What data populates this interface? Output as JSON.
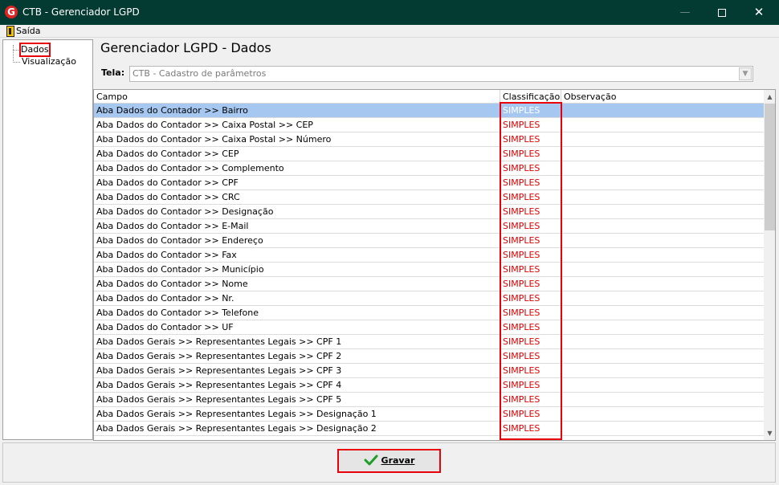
{
  "window": {
    "title": "CTB - Gerenciador LGPD",
    "app_icon_letter": "G",
    "minimize_glyph": "—",
    "close_glyph": "✕"
  },
  "menu": {
    "saida": "Saída"
  },
  "tree": {
    "items": [
      {
        "label": "Dados",
        "selected": true
      },
      {
        "label": "Visualização",
        "selected": false
      }
    ]
  },
  "header": {
    "title": "Gerenciador LGPD - Dados"
  },
  "tela": {
    "label": "Tela:",
    "value": "CTB - Cadastro de parâmetros",
    "arrow": "▼"
  },
  "grid": {
    "columns": [
      "Campo",
      "Classificação",
      "Observação"
    ],
    "rows": [
      {
        "campo": "Aba Dados do Contador >> Bairro",
        "classificacao": "SIMPLES",
        "observacao": ""
      },
      {
        "campo": "Aba Dados do Contador >> Caixa Postal >> CEP",
        "classificacao": "SIMPLES",
        "observacao": ""
      },
      {
        "campo": "Aba Dados do Contador >> Caixa Postal >> Número",
        "classificacao": "SIMPLES",
        "observacao": ""
      },
      {
        "campo": "Aba Dados do Contador >> CEP",
        "classificacao": "SIMPLES",
        "observacao": ""
      },
      {
        "campo": "Aba Dados do Contador >> Complemento",
        "classificacao": "SIMPLES",
        "observacao": ""
      },
      {
        "campo": "Aba Dados do Contador >> CPF",
        "classificacao": "SIMPLES",
        "observacao": ""
      },
      {
        "campo": "Aba Dados do Contador >> CRC",
        "classificacao": "SIMPLES",
        "observacao": ""
      },
      {
        "campo": "Aba Dados do Contador >> Designação",
        "classificacao": "SIMPLES",
        "observacao": ""
      },
      {
        "campo": "Aba Dados do Contador >> E-Mail",
        "classificacao": "SIMPLES",
        "observacao": ""
      },
      {
        "campo": "Aba Dados do Contador >> Endereço",
        "classificacao": "SIMPLES",
        "observacao": ""
      },
      {
        "campo": "Aba Dados do Contador >> Fax",
        "classificacao": "SIMPLES",
        "observacao": ""
      },
      {
        "campo": "Aba Dados do Contador >> Município",
        "classificacao": "SIMPLES",
        "observacao": ""
      },
      {
        "campo": "Aba Dados do Contador >> Nome",
        "classificacao": "SIMPLES",
        "observacao": ""
      },
      {
        "campo": "Aba Dados do Contador >> Nr.",
        "classificacao": "SIMPLES",
        "observacao": ""
      },
      {
        "campo": "Aba Dados do Contador >> Telefone",
        "classificacao": "SIMPLES",
        "observacao": ""
      },
      {
        "campo": "Aba Dados do Contador >> UF",
        "classificacao": "SIMPLES",
        "observacao": ""
      },
      {
        "campo": "Aba Dados Gerais >> Representantes Legais >> CPF 1",
        "classificacao": "SIMPLES",
        "observacao": ""
      },
      {
        "campo": "Aba Dados Gerais >> Representantes Legais >> CPF 2",
        "classificacao": "SIMPLES",
        "observacao": ""
      },
      {
        "campo": "Aba Dados Gerais >> Representantes Legais >> CPF 3",
        "classificacao": "SIMPLES",
        "observacao": ""
      },
      {
        "campo": "Aba Dados Gerais >> Representantes Legais >> CPF 4",
        "classificacao": "SIMPLES",
        "observacao": ""
      },
      {
        "campo": "Aba Dados Gerais >> Representantes Legais >> CPF 5",
        "classificacao": "SIMPLES",
        "observacao": ""
      },
      {
        "campo": "Aba Dados Gerais >> Representantes Legais >> Designação 1",
        "classificacao": "SIMPLES",
        "observacao": ""
      },
      {
        "campo": "Aba Dados Gerais >> Representantes Legais >> Designação 2",
        "classificacao": "SIMPLES",
        "observacao": ""
      }
    ],
    "selected_row": 0
  },
  "footer": {
    "gravar_label": "Gravar"
  },
  "colors": {
    "titlebar": "#033b33",
    "highlight": "#e8000b",
    "selected_row": "#a6c7f0",
    "classificacao_text": "#e00000",
    "check_green": "#1f9d2a"
  },
  "icons": {
    "app": "app-logo-icon",
    "exit": "exit-door-icon",
    "save": "checkmark-icon"
  }
}
